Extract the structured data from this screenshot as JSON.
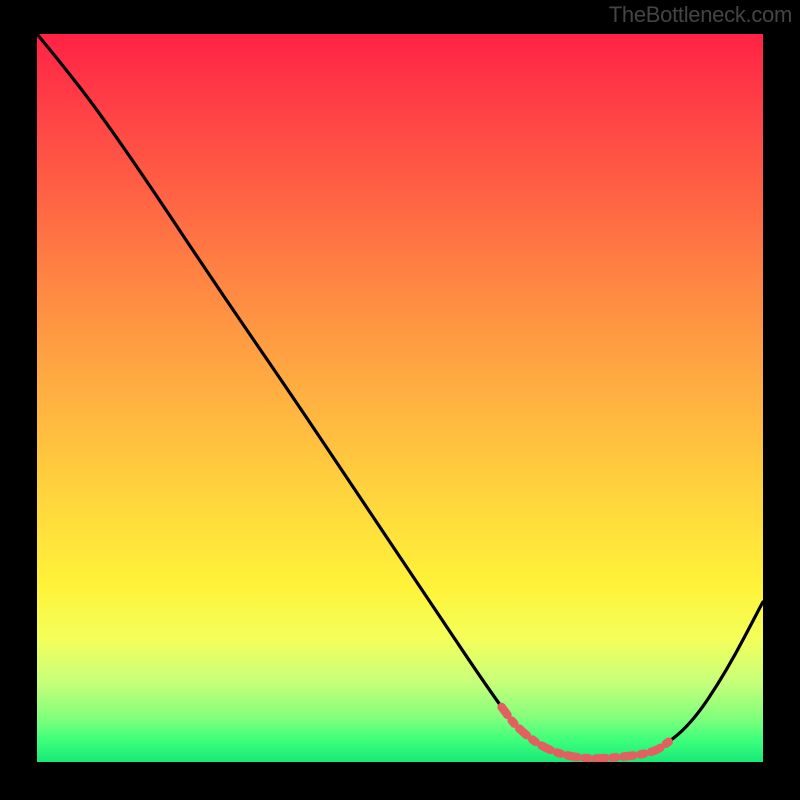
{
  "watermark": "TheBottleneck.com",
  "colors": {
    "background": "#000000",
    "curve_main": "#000000",
    "curve_trough": "#e16060",
    "gradient_top": "#ff2245",
    "gradient_bottom": "#18e978"
  },
  "chart_data": {
    "type": "line",
    "title": "",
    "xlabel": "",
    "ylabel": "",
    "xlim": [
      0,
      100
    ],
    "ylim": [
      0,
      100
    ],
    "grid": false,
    "legend": false,
    "series": [
      {
        "name": "bottleneck-curve",
        "x": [
          0,
          3.3,
          8,
          15,
          25,
          35,
          45,
          55,
          62,
          66,
          70,
          75,
          80,
          85,
          90,
          95,
          100
        ],
        "values": [
          100,
          96,
          90,
          80,
          65,
          50.5,
          35.6,
          20.7,
          10.3,
          4.8,
          1.7,
          0.4,
          0.6,
          1.3,
          5,
          12.5,
          22.0
        ]
      }
    ],
    "annotations": [
      {
        "name": "trough-highlight",
        "x_range": [
          64,
          87
        ],
        "style": "thick-red-dashed"
      }
    ]
  }
}
